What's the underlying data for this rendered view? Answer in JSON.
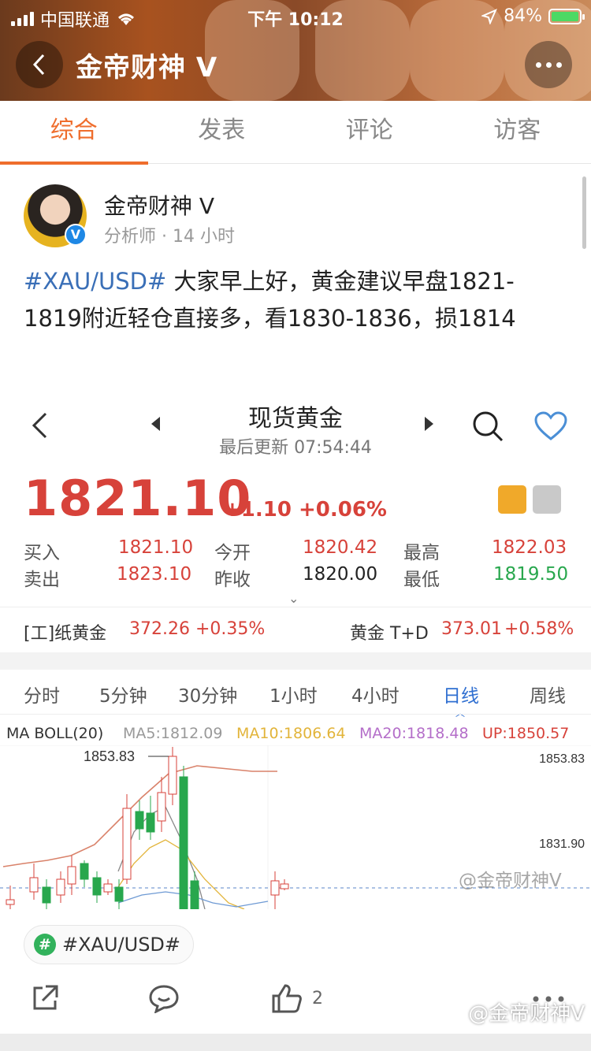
{
  "status_bar": {
    "carrier": "中国联通",
    "time": "下午 10:12",
    "battery": "84%"
  },
  "nav": {
    "title": "金帝财神 V"
  },
  "tabs": [
    {
      "label": "综合",
      "active": true
    },
    {
      "label": "发表",
      "active": false
    },
    {
      "label": "评论",
      "active": false
    },
    {
      "label": "访客",
      "active": false
    }
  ],
  "post": {
    "author": "金帝财神 V",
    "meta": "分析师 · 14 小时",
    "hashtag": "#XAU/USD#",
    "text": " 大家早上好，黄金建议早盘1821-1819附近轻仓直接多，看1830-1836，损1814"
  },
  "quote": {
    "title": "现货黄金",
    "updated": "最后更新 07:54:44",
    "price": "1821.10",
    "change": "+1.10 +0.06%",
    "rows": [
      [
        {
          "label": "买入",
          "value": "1821.10",
          "tone": "red"
        },
        {
          "label": "今开",
          "value": "1820.42",
          "tone": "red"
        },
        {
          "label": "最高",
          "value": "1822.03",
          "tone": "red"
        }
      ],
      [
        {
          "label": "卖出",
          "value": "1823.10",
          "tone": "red"
        },
        {
          "label": "昨收",
          "value": "1820.00",
          "tone": "dark"
        },
        {
          "label": "最低",
          "value": "1819.50",
          "tone": "green"
        }
      ]
    ],
    "paper_gold": {
      "label": "[工]纸黄金",
      "value": "372.26",
      "change": "+0.35%"
    },
    "td_gold": {
      "label": "黄金 T+D",
      "value": "373.01",
      "change": "+0.58%"
    },
    "periods": [
      "分时",
      "5分钟",
      "30分钟",
      "1小时",
      "4小时",
      "日线",
      "周线"
    ],
    "active_period": "日线",
    "ma": {
      "label": "MA BOLL(20)",
      "ma5": "MA5:1812.09",
      "ma10": "MA10:1806.64",
      "ma20": "MA20:1818.48",
      "up": "UP:1850.57"
    },
    "chart": {
      "high_label": "1853.83",
      "axis_top": "1853.83",
      "axis_mid": "1831.90"
    },
    "watermark": "@金帝财神V"
  },
  "footer": {
    "tag": "#XAU/USD#",
    "like_count": "2",
    "watermark": "@金帝财神V"
  },
  "colors": {
    "accent": "#ef6d2c",
    "price_up": "#d7423a",
    "price_down": "#28a74d",
    "link": "#3a6fb7",
    "active_period": "#2f6fd1"
  },
  "chart_data": {
    "type": "candlestick",
    "title": "",
    "series": [
      {
        "name": "MA5",
        "value": 1812.09
      },
      {
        "name": "MA10",
        "value": 1806.64
      },
      {
        "name": "MA20",
        "value": 1818.48
      },
      {
        "name": "UP",
        "value": 1850.57
      }
    ],
    "y_ticks": [
      1853.83,
      1831.9
    ],
    "annotated_high": 1853.83,
    "ylim": [
      1800,
      1860
    ]
  }
}
